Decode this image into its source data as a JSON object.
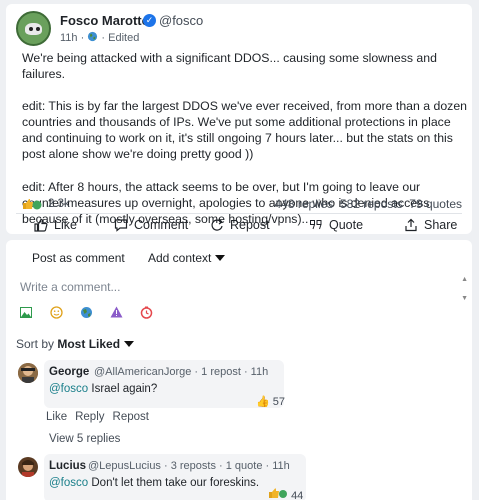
{
  "post": {
    "author": "Fosco Marotto",
    "handle": "@fosco",
    "time": "11h",
    "edited": "Edited",
    "paragraphs": [
      "We're being attacked with a significant DDOS... causing some slowness and failures.",
      "edit: This is by far the largest DDOS we've ever received, from more than a dozen countries and thousands of IPs. We've put some additional protections in place and continuing to work on it, it's still ongoing 7 hours later... but the stats on this post alone show we're doing pretty good ))",
      "edit: After 8 hours, the attack seems to be over, but I'm going to leave our counter-measures up overnight, apologies to anyone who is denied access because of it (mostly overseas, some hosting/vpns).."
    ],
    "reactions": "2.3k",
    "replies": "448 replies",
    "reposts": "582 reposts",
    "quotes": "79 quotes",
    "actions": {
      "like": "Like",
      "comment": "Comment",
      "repost": "Repost",
      "quote": "Quote",
      "share": "Share"
    },
    "colors": {
      "verified": "#1d74e9"
    }
  },
  "comments_section": {
    "tab_post": "Post as comment",
    "tab_context": "Add context",
    "input_placeholder": "Write a comment...",
    "sort_label": "Sort by",
    "sort_value": "Most Liked",
    "toolbar_icons": [
      "image-icon",
      "emoji-icon",
      "globe-icon",
      "warning-icon",
      "clock-icon"
    ],
    "comments": [
      {
        "name": "George",
        "handle": "@AllAmericanJorge",
        "meta": "1 repost · 11h",
        "mention": "@fosco",
        "text": "Israel again?",
        "likes": "57",
        "actions": {
          "like": "Like",
          "reply": "Reply",
          "repost": "Repost"
        },
        "replies": "View 5 replies"
      },
      {
        "name": "Lucius",
        "handle": "@LepusLucius",
        "meta": "3 reposts · 1 quote · 11h",
        "mention": "@fosco",
        "text": "Don't let them take our foreskins.",
        "likes": "44"
      }
    ]
  }
}
